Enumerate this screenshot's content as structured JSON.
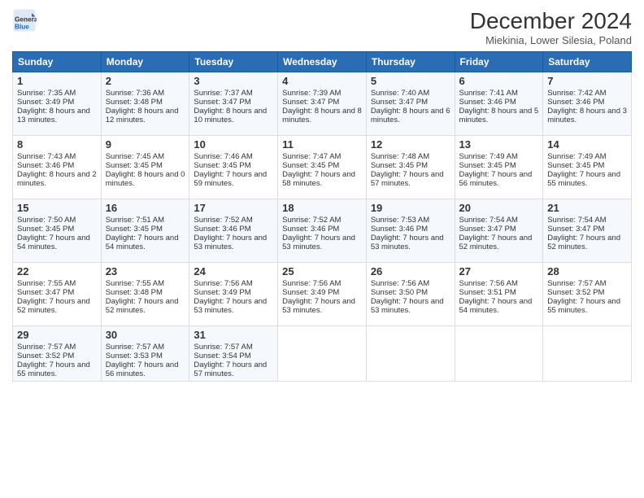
{
  "logo": {
    "general": "General",
    "blue": "Blue"
  },
  "header": {
    "month": "December 2024",
    "location": "Miekinia, Lower Silesia, Poland"
  },
  "days": [
    "Sunday",
    "Monday",
    "Tuesday",
    "Wednesday",
    "Thursday",
    "Friday",
    "Saturday"
  ],
  "weeks": [
    [
      {
        "day": "1",
        "sunrise": "7:35 AM",
        "sunset": "3:49 PM",
        "daylight": "8 hours and 13 minutes."
      },
      {
        "day": "2",
        "sunrise": "7:36 AM",
        "sunset": "3:48 PM",
        "daylight": "8 hours and 12 minutes."
      },
      {
        "day": "3",
        "sunrise": "7:37 AM",
        "sunset": "3:47 PM",
        "daylight": "8 hours and 10 minutes."
      },
      {
        "day": "4",
        "sunrise": "7:39 AM",
        "sunset": "3:47 PM",
        "daylight": "8 hours and 8 minutes."
      },
      {
        "day": "5",
        "sunrise": "7:40 AM",
        "sunset": "3:47 PM",
        "daylight": "8 hours and 6 minutes."
      },
      {
        "day": "6",
        "sunrise": "7:41 AM",
        "sunset": "3:46 PM",
        "daylight": "8 hours and 5 minutes."
      },
      {
        "day": "7",
        "sunrise": "7:42 AM",
        "sunset": "3:46 PM",
        "daylight": "8 hours and 3 minutes."
      }
    ],
    [
      {
        "day": "8",
        "sunrise": "7:43 AM",
        "sunset": "3:46 PM",
        "daylight": "8 hours and 2 minutes."
      },
      {
        "day": "9",
        "sunrise": "7:45 AM",
        "sunset": "3:45 PM",
        "daylight": "8 hours and 0 minutes."
      },
      {
        "day": "10",
        "sunrise": "7:46 AM",
        "sunset": "3:45 PM",
        "daylight": "7 hours and 59 minutes."
      },
      {
        "day": "11",
        "sunrise": "7:47 AM",
        "sunset": "3:45 PM",
        "daylight": "7 hours and 58 minutes."
      },
      {
        "day": "12",
        "sunrise": "7:48 AM",
        "sunset": "3:45 PM",
        "daylight": "7 hours and 57 minutes."
      },
      {
        "day": "13",
        "sunrise": "7:49 AM",
        "sunset": "3:45 PM",
        "daylight": "7 hours and 56 minutes."
      },
      {
        "day": "14",
        "sunrise": "7:49 AM",
        "sunset": "3:45 PM",
        "daylight": "7 hours and 55 minutes."
      }
    ],
    [
      {
        "day": "15",
        "sunrise": "7:50 AM",
        "sunset": "3:45 PM",
        "daylight": "7 hours and 54 minutes."
      },
      {
        "day": "16",
        "sunrise": "7:51 AM",
        "sunset": "3:45 PM",
        "daylight": "7 hours and 54 minutes."
      },
      {
        "day": "17",
        "sunrise": "7:52 AM",
        "sunset": "3:46 PM",
        "daylight": "7 hours and 53 minutes."
      },
      {
        "day": "18",
        "sunrise": "7:52 AM",
        "sunset": "3:46 PM",
        "daylight": "7 hours and 53 minutes."
      },
      {
        "day": "19",
        "sunrise": "7:53 AM",
        "sunset": "3:46 PM",
        "daylight": "7 hours and 53 minutes."
      },
      {
        "day": "20",
        "sunrise": "7:54 AM",
        "sunset": "3:47 PM",
        "daylight": "7 hours and 52 minutes."
      },
      {
        "day": "21",
        "sunrise": "7:54 AM",
        "sunset": "3:47 PM",
        "daylight": "7 hours and 52 minutes."
      }
    ],
    [
      {
        "day": "22",
        "sunrise": "7:55 AM",
        "sunset": "3:47 PM",
        "daylight": "7 hours and 52 minutes."
      },
      {
        "day": "23",
        "sunrise": "7:55 AM",
        "sunset": "3:48 PM",
        "daylight": "7 hours and 52 minutes."
      },
      {
        "day": "24",
        "sunrise": "7:56 AM",
        "sunset": "3:49 PM",
        "daylight": "7 hours and 53 minutes."
      },
      {
        "day": "25",
        "sunrise": "7:56 AM",
        "sunset": "3:49 PM",
        "daylight": "7 hours and 53 minutes."
      },
      {
        "day": "26",
        "sunrise": "7:56 AM",
        "sunset": "3:50 PM",
        "daylight": "7 hours and 53 minutes."
      },
      {
        "day": "27",
        "sunrise": "7:56 AM",
        "sunset": "3:51 PM",
        "daylight": "7 hours and 54 minutes."
      },
      {
        "day": "28",
        "sunrise": "7:57 AM",
        "sunset": "3:52 PM",
        "daylight": "7 hours and 55 minutes."
      }
    ],
    [
      {
        "day": "29",
        "sunrise": "7:57 AM",
        "sunset": "3:52 PM",
        "daylight": "7 hours and 55 minutes."
      },
      {
        "day": "30",
        "sunrise": "7:57 AM",
        "sunset": "3:53 PM",
        "daylight": "7 hours and 56 minutes."
      },
      {
        "day": "31",
        "sunrise": "7:57 AM",
        "sunset": "3:54 PM",
        "daylight": "7 hours and 57 minutes."
      },
      null,
      null,
      null,
      null
    ]
  ]
}
